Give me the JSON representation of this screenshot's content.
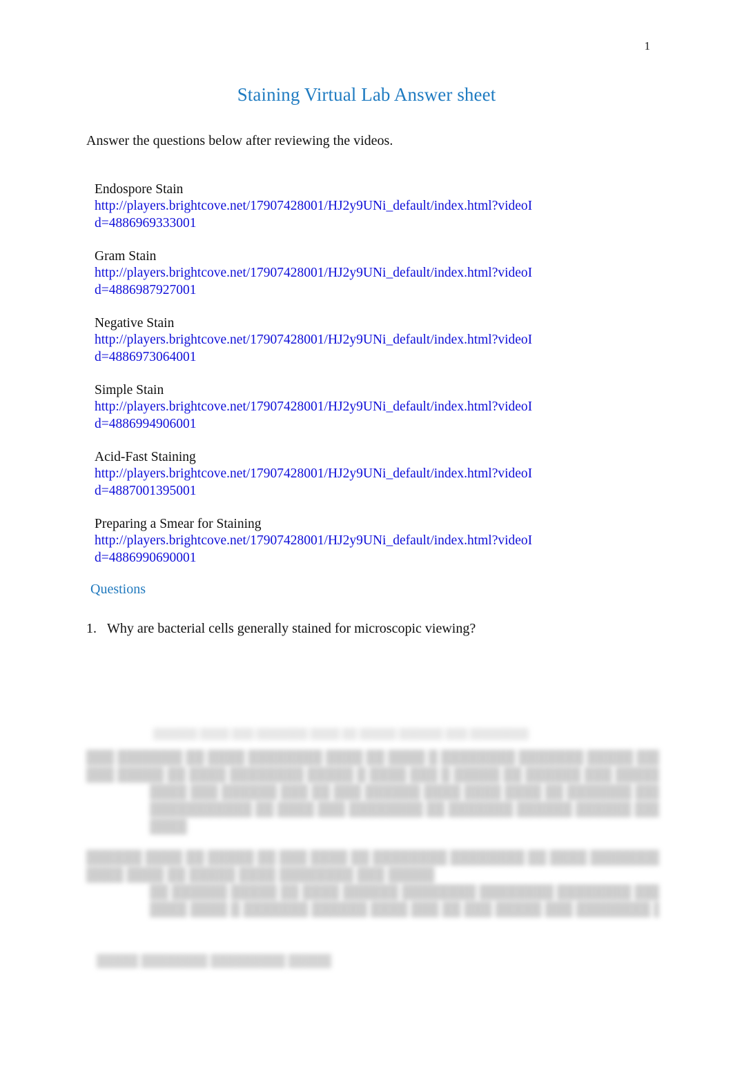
{
  "document": {
    "page_number": "1",
    "title": "Staining Virtual Lab Answer sheet",
    "intro": "Answer the questions below after reviewing the videos.",
    "title_color": "#1F7BC1",
    "link_color": "#1010D8",
    "heading_color": "#2079BE"
  },
  "videos": [
    {
      "label": "Endospore Stain",
      "url": "http://players.brightcove.net/17907428001/HJ2y9UNi_default/index.html?videoId=4886969333001"
    },
    {
      "label": "Gram Stain",
      "url": "http://players.brightcove.net/17907428001/HJ2y9UNi_default/index.html?videoId=4886987927001"
    },
    {
      "label": "Negative Stain",
      "url": "http://players.brightcove.net/17907428001/HJ2y9UNi_default/index.html?videoId=4886973064001"
    },
    {
      "label": "Simple Stain",
      "url": "http://players.brightcove.net/17907428001/HJ2y9UNi_default/index.html?videoId=4886994906001"
    },
    {
      "label": "Acid-Fast Staining",
      "url": "http://players.brightcove.net/17907428001/HJ2y9UNi_default/index.html?videoId=4887001395001"
    },
    {
      "label": "Preparing a Smear for Staining",
      "url": "http://players.brightcove.net/17907428001/HJ2y9UNi_default/index.html?videoId=4886990690001"
    }
  ],
  "questions_section": {
    "heading": "Questions",
    "items": [
      {
        "number": "1.",
        "text": "Why are bacterial cells generally stained for microscopic viewing?"
      }
    ]
  },
  "obscured": {
    "note": "blurred-illegible",
    "top_line": "██████ ████ ███ ███████ ████ ██ █████ ██████ ███ ████████",
    "block_two": {
      "number": "2.",
      "lines": [
        "███ ███████ ██ ████ ████████ ████ ██ ████ █ ████████ ███████ █████ ████ ██ ████ █████",
        "███ █████ ██ ████ ████████ █████ █ ████ ███ █ █████ ██ ██████ ███ █████"
      ],
      "sub_lines": [
        "████ ███ ██████ ███ ██ ███ ██████ ████ ████ ████ ██ ███████ ███████",
        "███████████ ██ ████ ███ ████████ ██ ███████ ██████ ██████ ████████ ███████",
        "████"
      ]
    },
    "block_three": {
      "number": "3.",
      "lines": [
        "██████ ████ ██ █████ ██ ███ ████ ██ ████████ ████████ ██ ████ ████████ █████ █",
        "████ ████ ██ █████ ████ ████████ ███ █████"
      ],
      "sub_lines": [
        "██ ██████ █████ ██ ████ ██████ ████████ ████████ ████████ ██████ ██ ██████",
        "████ ████ █ ███████ ██████ ████ ███ ██ ███ █████ ███ ████████ █████ ██ ███ ███"
      ]
    },
    "footer_line": "█████ ████████ █████████ ███████ ███████"
  }
}
